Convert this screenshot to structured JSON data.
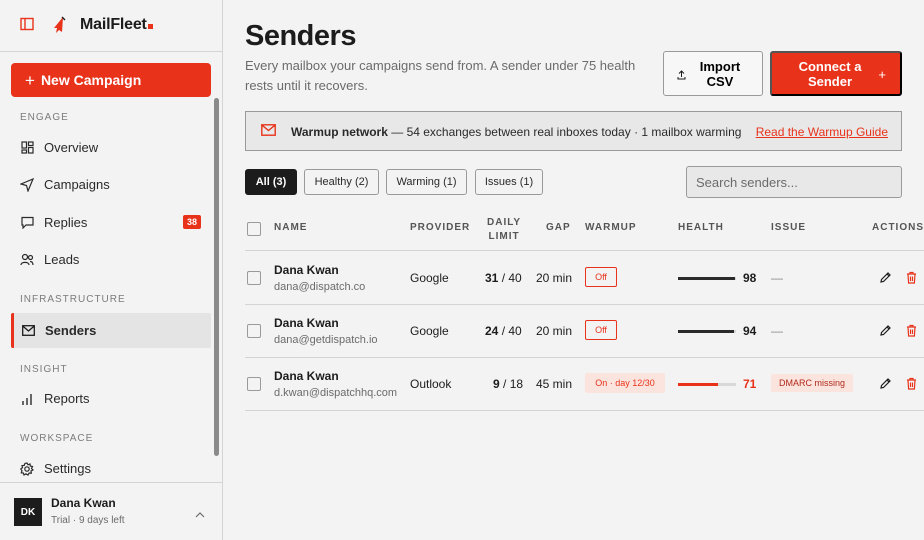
{
  "brand": {
    "name": "MailFleet"
  },
  "sidebar": {
    "new_campaign_label": "New Campaign",
    "sections": {
      "engage": "ENGAGE",
      "infrastructure": "INFRASTRUCTURE",
      "insight": "INSIGHT",
      "workspace": "WORKSPACE"
    },
    "items": {
      "overview": "Overview",
      "campaigns": "Campaigns",
      "replies": "Replies",
      "replies_badge": "38",
      "leads": "Leads",
      "senders": "Senders",
      "reports": "Reports",
      "settings": "Settings"
    },
    "user": {
      "initials": "DK",
      "name": "Dana Kwan",
      "plan": "Trial · 9 days left"
    }
  },
  "header": {
    "title": "Senders",
    "subtitle": "Every mailbox your campaigns send from. A sender under 75 health rests until it recovers.",
    "import_label": "Import CSV",
    "connect_label": "Connect a Sender"
  },
  "banner": {
    "title": "Warmup network",
    "text": " — 54 exchanges between real inboxes today · 1 mailbox warming",
    "link": "Read the Warmup Guide"
  },
  "filters": {
    "all": "All (3)",
    "healthy": "Healthy (2)",
    "warming": "Warming (1)",
    "issues": "Issues (1)"
  },
  "search": {
    "placeholder": "Search senders..."
  },
  "table": {
    "headers": {
      "name": "NAME",
      "provider": "PROVIDER",
      "daily_limit_1": "DAILY",
      "daily_limit_2": "LIMIT",
      "gap": "GAP",
      "warmup": "WARMUP",
      "health": "HEALTH",
      "issue": "ISSUE",
      "actions": "ACTIONS"
    },
    "rows": [
      {
        "name": "Dana Kwan",
        "email": "dana@dispatch.co",
        "provider": "Google",
        "sent": "31",
        "limit": " / 40",
        "gap": "20 min",
        "warmup": "Off",
        "health": "98",
        "health_pct": 98,
        "issue": "—"
      },
      {
        "name": "Dana Kwan",
        "email": "dana@getdispatch.io",
        "provider": "Google",
        "sent": "24",
        "limit": " / 40",
        "gap": "20 min",
        "warmup": "Off",
        "health": "94",
        "health_pct": 94,
        "issue": "—"
      },
      {
        "name": "Dana Kwan",
        "email": "d.kwan@dispatchhq.com",
        "provider": "Outlook",
        "sent": "9",
        "limit": " / 18",
        "gap": "45 min",
        "warmup": "On · day 12/30",
        "health": "71",
        "health_pct": 71,
        "issue": "DMARC missing"
      }
    ]
  },
  "colors": {
    "accent": "#e8321a",
    "text": "#1c1c1c",
    "muted": "#6b6b6b",
    "background": "#f3f3f3"
  }
}
